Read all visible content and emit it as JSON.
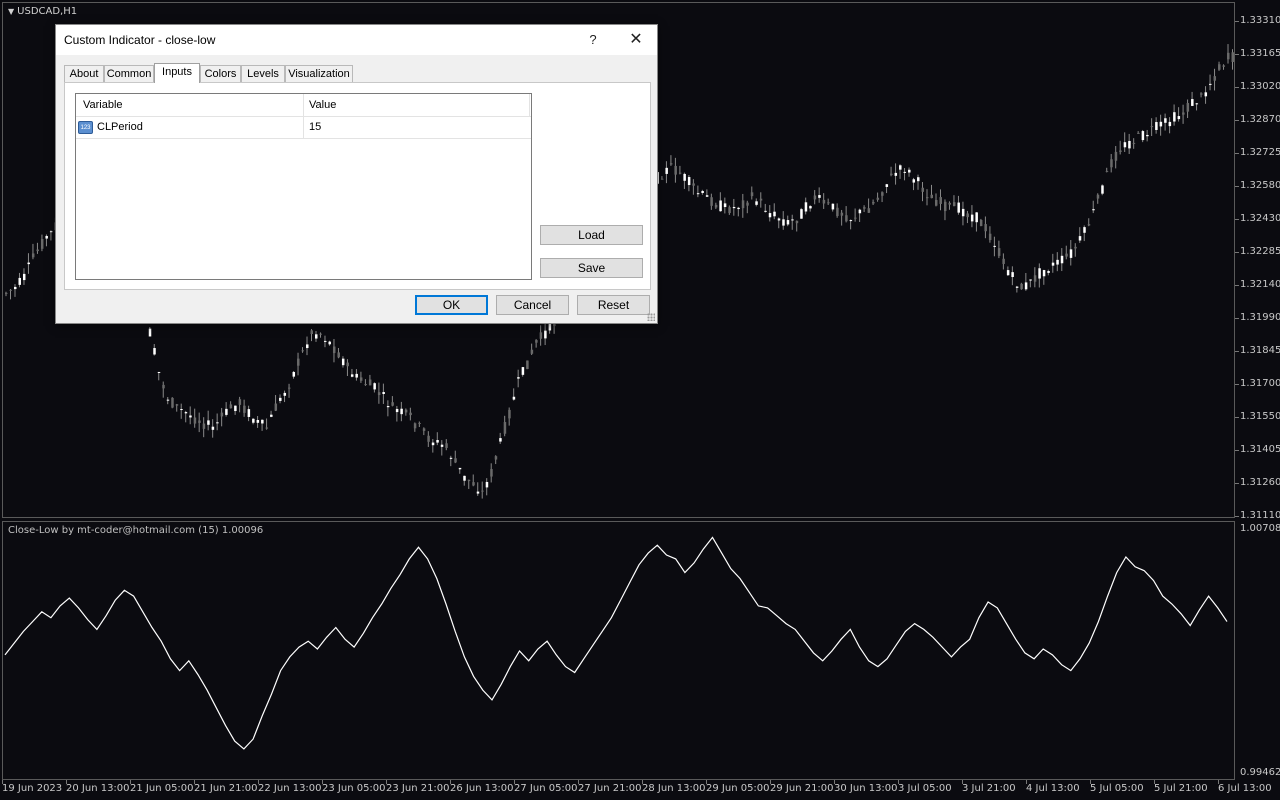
{
  "main_chart": {
    "title": "USDCAD,H1",
    "price_labels": [
      "1.33310",
      "1.33165",
      "1.33020",
      "1.32870",
      "1.32725",
      "1.32580",
      "1.32430",
      "1.32285",
      "1.32140",
      "1.31990",
      "1.31845",
      "1.31700",
      "1.31550",
      "1.31405",
      "1.31260",
      "1.31110"
    ]
  },
  "indicator_window": {
    "title": "Close-Low by mt-coder@hotmail.com (15) 1.00096",
    "max_label": "1.00708",
    "min_label": "0.99462"
  },
  "time_labels": [
    "19 Jun 2023",
    "20 Jun 13:00",
    "21 Jun 05:00",
    "21 Jun 21:00",
    "22 Jun 13:00",
    "23 Jun 05:00",
    "23 Jun 21:00",
    "26 Jun 13:00",
    "27 Jun 05:00",
    "27 Jun 21:00",
    "28 Jun 13:00",
    "29 Jun 05:00",
    "29 Jun 21:00",
    "30 Jun 13:00",
    "3 Jul 05:00",
    "3 Jul 21:00",
    "4 Jul 13:00",
    "5 Jul 05:00",
    "5 Jul 21:00",
    "6 Jul 13:00"
  ],
  "chart_data": {
    "type": "line",
    "ylim": [
      0.99462,
      1.00708
    ],
    "series": [
      {
        "values": [
          1.0006,
          1.0012,
          1.0018,
          1.0023,
          1.0028,
          1.0025,
          1.0031,
          1.0035,
          1.003,
          1.0024,
          1.0019,
          1.0026,
          1.0034,
          1.0039,
          1.0036,
          1.0028,
          1.002,
          1.0013,
          1.0004,
          0.9998,
          1.0003,
          0.9996,
          0.9988,
          0.9979,
          0.997,
          0.9962,
          0.9958,
          0.9963,
          0.9975,
          0.9986,
          0.9998,
          1.0005,
          1.001,
          1.0013,
          1.0009,
          1.0015,
          1.002,
          1.0014,
          1.001,
          1.0017,
          1.0025,
          1.0032,
          1.004,
          1.0047,
          1.0055,
          1.0061,
          1.0055,
          1.0045,
          1.0032,
          1.0018,
          1.0005,
          0.9995,
          0.9988,
          0.9983,
          0.9991,
          1.0,
          1.0008,
          1.0003,
          1.0009,
          1.0013,
          1.0006,
          1.0,
          0.9997,
          1.0004,
          1.0011,
          1.0018,
          1.0025,
          1.0034,
          1.0043,
          1.0052,
          1.0058,
          1.0062,
          1.0057,
          1.0055,
          1.0048,
          1.0053,
          1.006,
          1.0066,
          1.0058,
          1.005,
          1.0045,
          1.0038,
          1.0031,
          1.003,
          1.0026,
          1.0022,
          1.0019,
          1.0013,
          1.0007,
          1.0003,
          1.0008,
          1.0014,
          1.0019,
          1.001,
          1.0003,
          1.0,
          1.0004,
          1.0011,
          1.0018,
          1.0022,
          1.0019,
          1.0015,
          1.001,
          1.0005,
          1.001,
          1.0014,
          1.0025,
          1.0033,
          1.003,
          1.0022,
          1.0014,
          1.0007,
          1.0004,
          1.0009,
          1.0006,
          1.0001,
          0.9998,
          1.0004,
          1.0012,
          1.0023,
          1.0036,
          1.0048,
          1.0056,
          1.0051,
          1.0049,
          1.0044,
          1.0036,
          1.0032,
          1.0027,
          1.0021,
          1.0029,
          1.0036,
          1.003,
          1.0023
        ]
      }
    ]
  }
}
